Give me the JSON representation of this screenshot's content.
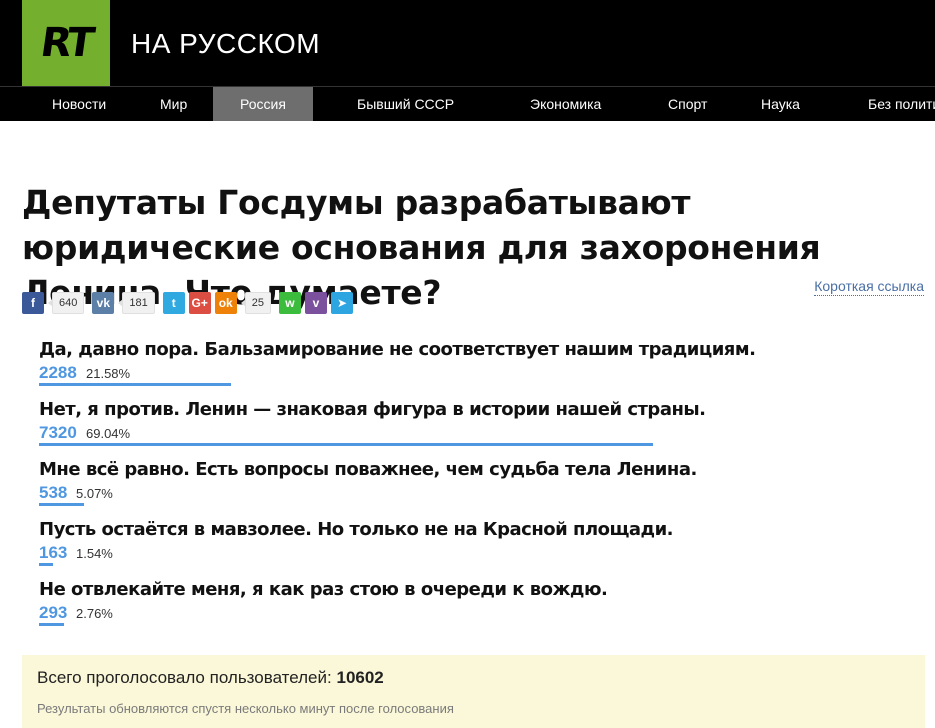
{
  "brand": {
    "logo": "RT",
    "title": "НА РУССКОМ"
  },
  "nav": [
    {
      "label": "Новости"
    },
    {
      "label": "Мир"
    },
    {
      "label": "Россия",
      "active": true
    },
    {
      "label": "Бывший СССР"
    },
    {
      "label": "Экономика"
    },
    {
      "label": "Спорт"
    },
    {
      "label": "Наука"
    },
    {
      "label": "Без полити"
    }
  ],
  "article": {
    "title": "Депутаты Госдумы разрабатывают юридические основания для захоронения Ленина. Что думаете?"
  },
  "share": {
    "facebook": {
      "icon": "facebook-icon",
      "glyph": "f",
      "color": "#3b5998",
      "count": "640"
    },
    "vk": {
      "icon": "vk-icon",
      "glyph": "vk",
      "color": "#5b7fa6",
      "count": "181"
    },
    "twitter": {
      "icon": "twitter-icon",
      "glyph": "t",
      "color": "#2fa9e0"
    },
    "googleplus": {
      "icon": "googleplus-icon",
      "glyph": "G+",
      "color": "#dc4e41"
    },
    "odnoklassniki": {
      "icon": "odnoklassniki-icon",
      "glyph": "ok",
      "color": "#ee8208",
      "count": "25"
    },
    "whatsapp": {
      "icon": "whatsapp-icon",
      "glyph": "w",
      "color": "#3cbc3c"
    },
    "viber": {
      "icon": "viber-icon",
      "glyph": "v",
      "color": "#7b519d"
    },
    "telegram": {
      "icon": "telegram-icon",
      "glyph": "➤",
      "color": "#2ca5e0"
    },
    "short_link": "Короткая ссылка"
  },
  "poll": {
    "accent": "#4f97e0",
    "options": [
      {
        "label": "Да, давно пора. Бальзамирование не соответствует нашим традициям.",
        "count": "2288",
        "percent": "21.58%",
        "fraction": 0.2158
      },
      {
        "label": "Нет, я против. Ленин — знаковая фигура в истории нашей страны.",
        "count": "7320",
        "percent": "69.04%",
        "fraction": 0.6904
      },
      {
        "label": "Мне всё равно. Есть вопросы поважнее, чем судьба тела Ленина.",
        "count": "538",
        "percent": "5.07%",
        "fraction": 0.0507
      },
      {
        "label": "Пусть остаётся в мавзолее. Но только не на Красной площади.",
        "count": "163",
        "percent": "1.54%",
        "fraction": 0.0154
      },
      {
        "label": "Не отвлекайте меня, я как раз стою в очереди к вождю.",
        "count": "293",
        "percent": "2.76%",
        "fraction": 0.0276
      }
    ],
    "total_label": "Всего проголосовало пользователей:",
    "total_value": "10602",
    "note": "Результаты обновляются спустя несколько минут после голосования"
  }
}
